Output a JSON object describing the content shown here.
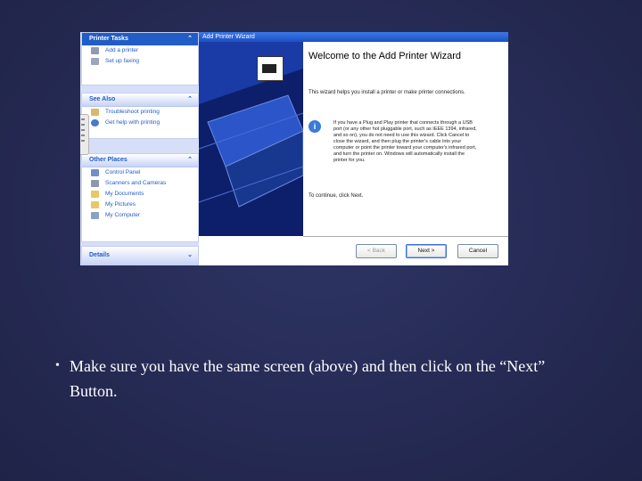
{
  "task_pane": {
    "printer_tasks": {
      "title": "Printer Tasks",
      "items": [
        "Add a printer",
        "Set up faxing"
      ]
    },
    "see_also": {
      "title": "See Also",
      "items": [
        "Troubleshoot printing",
        "Get help with printing"
      ]
    },
    "other_places": {
      "title": "Other Places",
      "items": [
        "Control Panel",
        "Scanners and Cameras",
        "My Documents",
        "My Pictures",
        "My Computer"
      ]
    },
    "details": {
      "title": "Details"
    }
  },
  "wizard": {
    "window_title": "Add Printer Wizard",
    "heading": "Welcome to the Add Printer Wizard",
    "intro": "This wizard helps you install a printer or make printer connections.",
    "info": "If you have a Plug and Play printer that connects through a USB port (or any other hot pluggable port, such as IEEE 1394, infrared, and so on), you do not need to use this wizard. Click Cancel to close the wizard, and then plug the printer's cable into your computer or point the printer toward your computer's infrared port, and turn the printer on. Windows will automatically install the printer for you.",
    "continue_text": "To continue, click Next.",
    "buttons": {
      "back": "< Back",
      "next": "Next >",
      "cancel": "Cancel"
    }
  },
  "caption": {
    "bullet": "•",
    "text": "Make sure you have the same screen (above) and then click on the “Next” Button."
  },
  "colors": {
    "background": "#262b55",
    "accent": "#215dc6",
    "banner": "#1a3ba6"
  }
}
